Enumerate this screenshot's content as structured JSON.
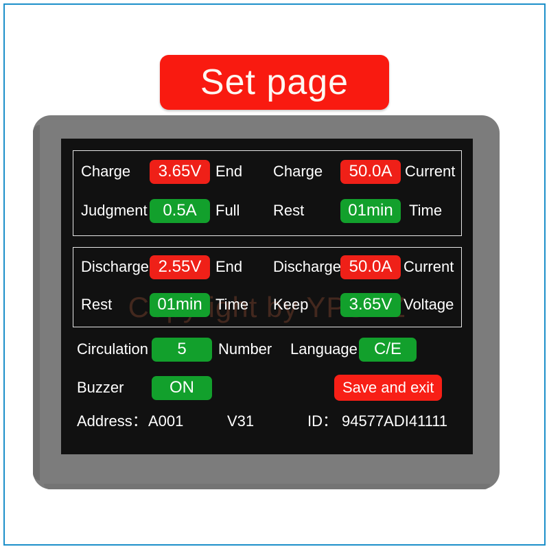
{
  "title_badge": {
    "label": "Set page"
  },
  "watermark": {
    "text": "Copyright by YPSDZ"
  },
  "colors": {
    "frame_blue": "#1b8fc9",
    "bezel_gray": "#7c7c7c",
    "screen_black": "#111111",
    "badge_red": "#ef2018",
    "badge_green": "#12a02c",
    "title_red": "#f91a10"
  },
  "charge_panel": {
    "rows": [
      {
        "left": {
          "prefix": "Charge",
          "value": "3.65V",
          "suffix": "End",
          "style": "red"
        },
        "right": {
          "prefix": "Charge",
          "value": "50.0A",
          "suffix": "Current",
          "style": "red"
        }
      },
      {
        "left": {
          "prefix": "Judgment",
          "value": "0.5A",
          "suffix": "Full",
          "style": "green"
        },
        "right": {
          "prefix": "Rest",
          "value": "01min",
          "suffix": "Time",
          "style": "green"
        }
      }
    ]
  },
  "discharge_panel": {
    "rows": [
      {
        "left": {
          "prefix": "Discharge",
          "value": "2.55V",
          "suffix": "End",
          "style": "red"
        },
        "right": {
          "prefix": "Discharge",
          "value": "50.0A",
          "suffix": "Current",
          "style": "red"
        }
      },
      {
        "left": {
          "prefix": "Rest",
          "value": "01min",
          "suffix": "Time",
          "style": "green"
        },
        "right": {
          "prefix": "Keep",
          "value": "3.65V",
          "suffix": "Voltage",
          "style": "green"
        }
      }
    ]
  },
  "settings": {
    "circulation": {
      "prefix": "Circulation",
      "value": "5",
      "suffix": "Number"
    },
    "language": {
      "prefix": "Language",
      "value": "C/E"
    },
    "buzzer": {
      "prefix": "Buzzer",
      "value": "ON"
    },
    "save_button": {
      "label": "Save and exit"
    }
  },
  "status_bar": {
    "address_label": "Address：",
    "address_value": "A001",
    "version": "V31",
    "id_label": "ID：",
    "id_value": "94577ADI41111"
  }
}
